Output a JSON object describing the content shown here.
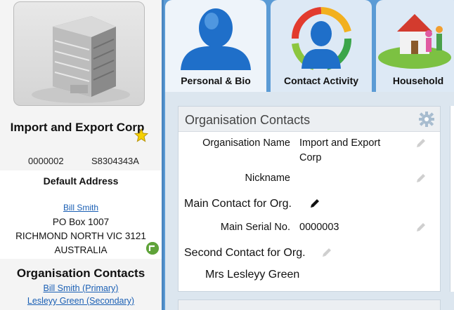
{
  "left_panel": {
    "org_name": "Import and Export Corp",
    "id_number": "0000002",
    "serial_code": "S8304343A",
    "default_address_title": "Default Address",
    "address_contact": "Bill Smith",
    "address_lines": [
      "PO Box 1007",
      "RICHMOND NORTH VIC 3121",
      "AUSTRALIA"
    ],
    "contacts_title": "Organisation Contacts",
    "contacts": [
      "Bill Smith (Primary)",
      "Lesleyy Green (Secondary)"
    ]
  },
  "tabs": [
    {
      "label": "Personal & Bio"
    },
    {
      "label": "Contact Activity"
    },
    {
      "label": "Household"
    }
  ],
  "card": {
    "title": "Organisation Contacts",
    "fields": {
      "org_name_label": "Organisation Name",
      "org_name_value": "Import and Export Corp",
      "nickname_label": "Nickname",
      "main_contact_label": "Main Contact for Org.",
      "main_serial_label": "Main Serial No.",
      "main_serial_value": "0000003",
      "second_contact_label": "Second Contact for Org.",
      "second_contact_value": "Mrs Lesleyy Green"
    }
  },
  "colors": {
    "tab_bg": "#dde9f5",
    "link": "#1a5fb4",
    "accent": "#5b9bd5"
  }
}
